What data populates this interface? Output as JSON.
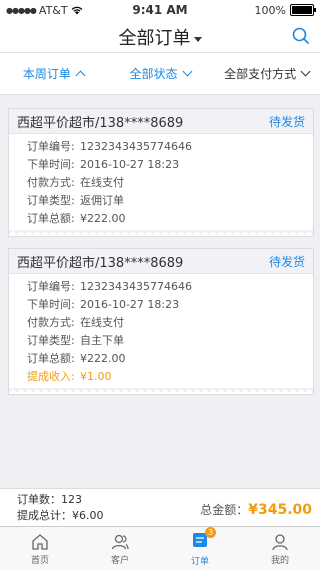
{
  "status_bar": {
    "carrier": "AT&T",
    "time": "9:41 AM",
    "battery": "100%"
  },
  "nav": {
    "title": "全部订单"
  },
  "filters": [
    {
      "label": "本周订单"
    },
    {
      "label": "全部状态"
    },
    {
      "label": "全部支付方式"
    }
  ],
  "orders": [
    {
      "shop": "西超平价超市/138****8689",
      "status": "待发货",
      "fields": [
        {
          "k": "订单编号:",
          "v": "1232343435774646"
        },
        {
          "k": "下单时间:",
          "v": "2016-10-27 18:23"
        },
        {
          "k": "付款方式:",
          "v": "在线支付"
        },
        {
          "k": "订单类型:",
          "v": "返佣订单"
        },
        {
          "k": "订单总额:",
          "v": "¥222.00"
        }
      ]
    },
    {
      "shop": "西超平价超市/138****8689",
      "status": "待发货",
      "fields": [
        {
          "k": "订单编号:",
          "v": "1232343435774646"
        },
        {
          "k": "下单时间:",
          "v": "2016-10-27 18:23"
        },
        {
          "k": "付款方式:",
          "v": "在线支付"
        },
        {
          "k": "订单类型:",
          "v": "自主下单"
        },
        {
          "k": "订单总额:",
          "v": "¥222.00"
        }
      ],
      "commission": {
        "k": "提成收入:",
        "v": "¥1.00"
      }
    }
  ],
  "summary": {
    "order_count": "订单数：123",
    "commission_total": "提成总计：¥6.00",
    "total_label": "总金额：",
    "total_amount": "¥345.00"
  },
  "tabbar": {
    "items": [
      {
        "label": "首页",
        "icon": "home-icon"
      },
      {
        "label": "客户",
        "icon": "customers-icon"
      },
      {
        "label": "订单",
        "icon": "orders-icon",
        "badge": "3"
      },
      {
        "label": "我的",
        "icon": "profile-icon"
      }
    ]
  },
  "colors": {
    "accent": "#1e88e5",
    "highlight": "#f39c12"
  }
}
